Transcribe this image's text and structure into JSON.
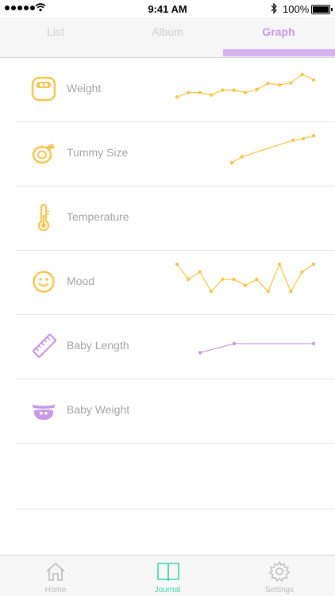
{
  "status": {
    "time": "9:41 AM",
    "battery": "100%"
  },
  "tabs": [
    {
      "label": "List",
      "active": false
    },
    {
      "label": "Album",
      "active": false
    },
    {
      "label": "Graph",
      "active": true
    }
  ],
  "colors": {
    "yellow": "#f6c54f",
    "purple": "#c69ae6",
    "accent": "#3fd2ae"
  },
  "rows": [
    {
      "label": "Weight",
      "icon": "scale-icon",
      "color": "#f6c54f",
      "series": [
        0.15,
        0.3,
        0.3,
        0.22,
        0.38,
        0.38,
        0.3,
        0.4,
        0.6,
        0.55,
        0.62,
        0.9,
        0.72
      ]
    },
    {
      "label": "Tummy Size",
      "icon": "tape-measure-icon",
      "color": "#f6c54f",
      "series": [
        0.1,
        0.3,
        null,
        null,
        null,
        null,
        0.85,
        0.9,
        1.0
      ],
      "x_start": 0.4
    },
    {
      "label": "Temperature",
      "icon": "thermometer-icon",
      "color": "#f6c54f",
      "series": []
    },
    {
      "label": "Mood",
      "icon": "smiley-icon",
      "color": "#f6c54f",
      "series": [
        1.0,
        0.5,
        0.75,
        0.1,
        0.5,
        0.5,
        0.3,
        0.5,
        0.1,
        1.0,
        0.1,
        0.75,
        1.0
      ]
    },
    {
      "label": "Baby Length",
      "icon": "ruler-icon",
      "color": "#c69ae6",
      "series": [
        0.2,
        0.5,
        0.5
      ]
    },
    {
      "label": "Baby Weight",
      "icon": "baby-scale-icon",
      "color": "#c69ae6",
      "series": []
    }
  ],
  "bottom_tabs": [
    {
      "label": "Home",
      "icon": "home-icon",
      "active": false
    },
    {
      "label": "Journal",
      "icon": "journal-icon",
      "active": true
    },
    {
      "label": "Settings",
      "icon": "gear-icon",
      "active": false
    }
  ]
}
